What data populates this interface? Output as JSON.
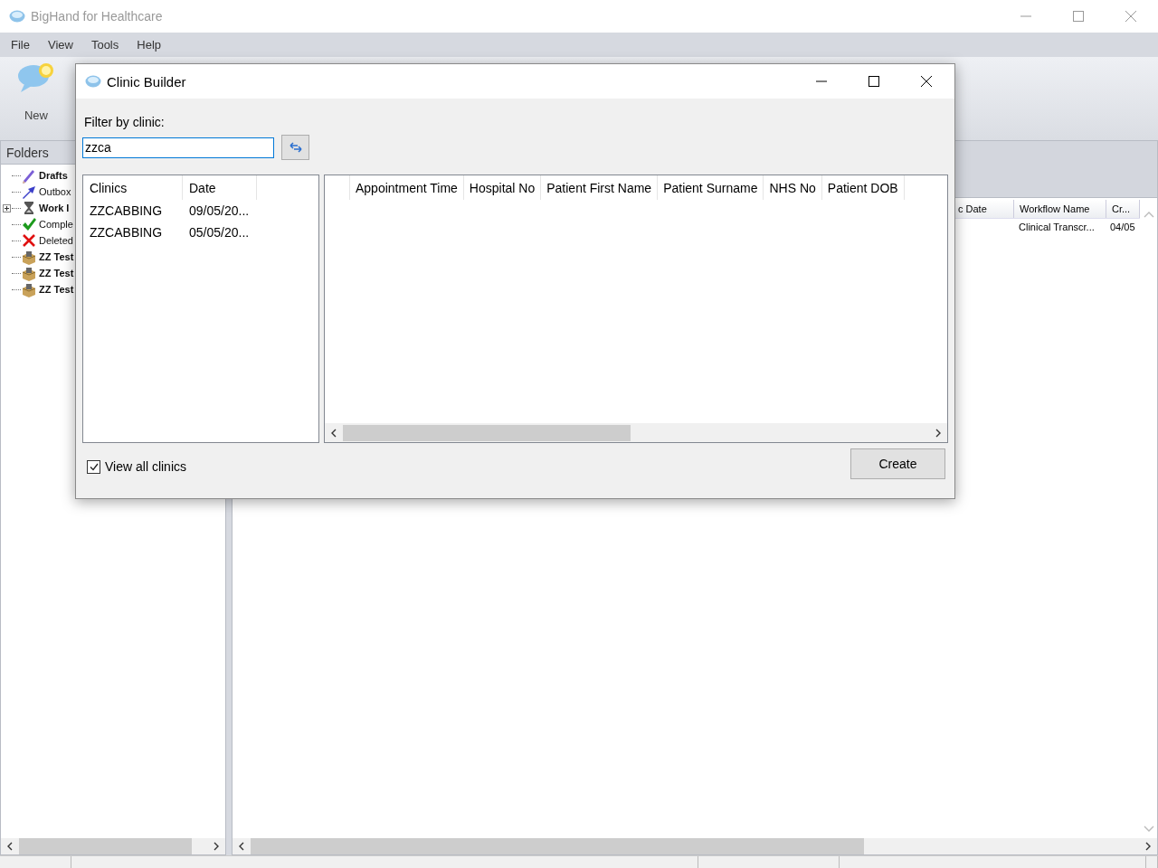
{
  "window": {
    "title": "BigHand for Healthcare"
  },
  "menu": [
    {
      "label": "File"
    },
    {
      "label": "View"
    },
    {
      "label": "Tools"
    },
    {
      "label": "Help"
    }
  ],
  "toolbar": [
    {
      "label": "New"
    }
  ],
  "folders": {
    "title": "Folders",
    "items": [
      {
        "label": "Drafts",
        "bold": true,
        "kind": "drafts",
        "collapsed": false
      },
      {
        "label": "Outbox",
        "bold": false,
        "kind": "outbox",
        "collapsed": false
      },
      {
        "label": "Work I",
        "bold": true,
        "kind": "work",
        "collapsed": true
      },
      {
        "label": "Comple",
        "bold": false,
        "kind": "complete",
        "collapsed": false
      },
      {
        "label": "Deleted",
        "bold": false,
        "kind": "deleted",
        "collapsed": false
      },
      {
        "label": "ZZ Test",
        "bold": true,
        "kind": "clinic",
        "collapsed": false
      },
      {
        "label": "ZZ Test",
        "bold": true,
        "kind": "clinic",
        "collapsed": false
      },
      {
        "label": "ZZ Test",
        "bold": true,
        "kind": "clinic",
        "collapsed": false
      }
    ]
  },
  "worklist": {
    "columns": [
      "c Date",
      "Workflow Name",
      "Cr..."
    ],
    "rows": [
      {
        "column_2": "Clinical Transcr...",
        "column_3": "04/05"
      }
    ]
  },
  "dialog": {
    "title": "Clinic Builder",
    "filter_label": "Filter by clinic:",
    "filter_value": "zzca",
    "clinics": {
      "columns": [
        "Clinics",
        "Date"
      ],
      "rows": [
        {
          "clinic": "ZZCABBING",
          "date": "09/05/20...",
          "selected": false
        },
        {
          "clinic": "ZZCABBING",
          "date": "05/05/20...",
          "selected": false
        }
      ]
    },
    "appointments": {
      "columns": [
        "Appointment Time",
        "Hospital No",
        "Patient First Name",
        "Patient Surname",
        "NHS No",
        "Patient DOB"
      ]
    },
    "view_all": {
      "label": "View all clinics",
      "checked": true
    },
    "create_button": "Create"
  }
}
